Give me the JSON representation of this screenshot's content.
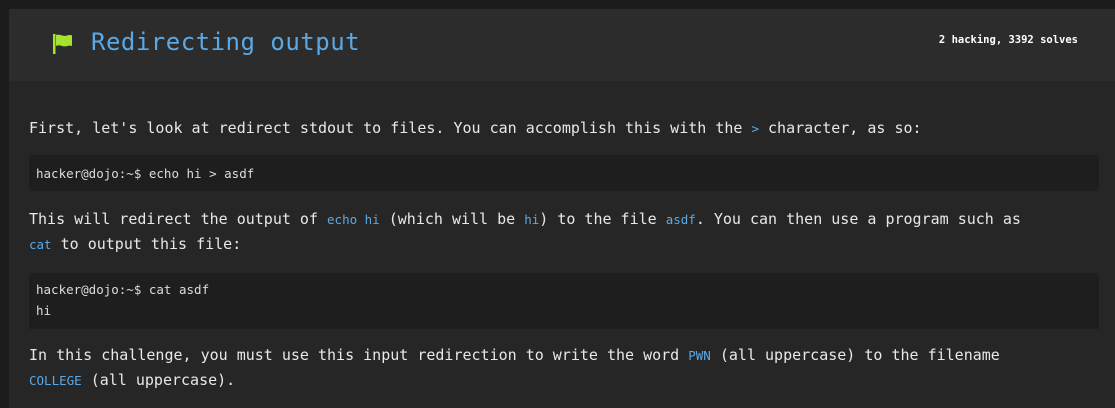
{
  "header": {
    "icon": "flag-icon",
    "flag_color": "#a6e22e",
    "title": "Redirecting output",
    "stats": "2 hacking, 3392 solves"
  },
  "content": {
    "p1": {
      "before": "First, let's look at redirect stdout to files. You can accomplish this with the ",
      "code": ">",
      "after": " character, as so:"
    },
    "block1": {
      "lines": [
        "hacker@dojo:~$ echo hi > asdf"
      ]
    },
    "p2": {
      "line1": {
        "t1": "This will redirect the output of ",
        "c1": "echo hi",
        "t2": " (which will be ",
        "c2": "hi",
        "t3": ") to the file ",
        "c3": "asdf",
        "t4": ". You can then use a program such as"
      },
      "line2": {
        "c1": "cat",
        "t1": " to output this file:"
      }
    },
    "block2": {
      "lines": [
        "hacker@dojo:~$ cat asdf",
        "hi"
      ]
    },
    "p3": {
      "line1": {
        "t1": "In this challenge, you must use this input redirection to write the word ",
        "c1": "PWN",
        "t2": " (all uppercase) to the filename"
      },
      "line2": {
        "c1": "COLLEGE",
        "t1": " (all uppercase)."
      }
    }
  },
  "colors": {
    "accent": "#5aa9e6",
    "header_bg": "#2c2c2c",
    "body_bg": "#262626",
    "code_bg": "#1e1e1e"
  }
}
